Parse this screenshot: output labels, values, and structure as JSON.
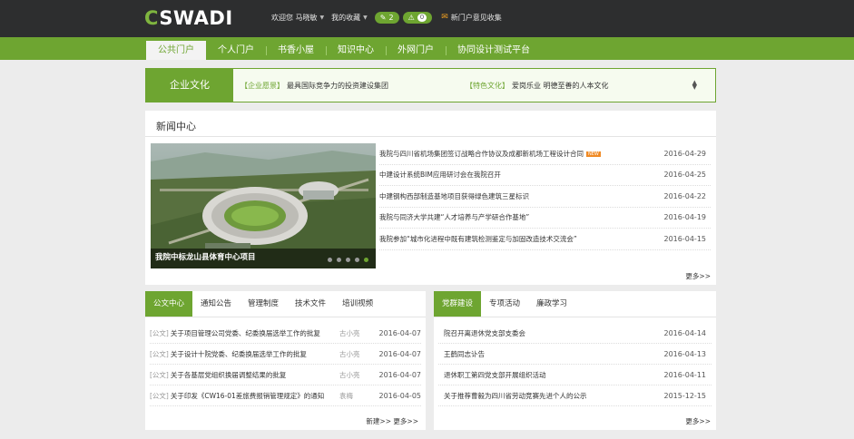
{
  "header": {
    "logo_c": "C",
    "logo_rest": "SWADI",
    "welcome": "欢迎您 马晓敏",
    "favorites": "我的收藏",
    "edit_count": "2",
    "warning_count": "0",
    "feedback": "新门户意见收集"
  },
  "nav": {
    "tabs": [
      "公共门户",
      "个人门户",
      "书香小屋",
      "知识中心",
      "外网门户",
      "协同设计测试平台"
    ]
  },
  "culture": {
    "heading": "企业文化",
    "vision_tag": "【企业愿景】",
    "vision_text": "最具国际竞争力的投资建设集团",
    "feature_tag": "【特色文化】",
    "feature_text": "爱岗乐业 明德至善的人本文化"
  },
  "news": {
    "title": "新闻中心",
    "photo_caption": "我院中标龙山县体育中心项目",
    "more": "更多>>",
    "items": [
      {
        "title": "我院与四川省机场集团签订战略合作协议及成都新机场工程设计合同",
        "badge": "NEW",
        "date": "2016-04-29"
      },
      {
        "title": "中建设计系统BIM应用研讨会在我院召开",
        "date": "2016-04-25"
      },
      {
        "title": "中建钢构西部制造基地项目获得绿色建筑三星标识",
        "date": "2016-04-22"
      },
      {
        "title": "我院与同济大学共建“人才培养与产学研合作基地”",
        "date": "2016-04-19"
      },
      {
        "title": "我院参加“城市化进程中既有建筑检测鉴定与加固改造技术交流会”",
        "date": "2016-04-15"
      }
    ]
  },
  "docs": {
    "tabs": [
      "公文中心",
      "通知公告",
      "管理制度",
      "技术文件",
      "培训视频"
    ],
    "new_link": "新建>>",
    "more": "更多>>",
    "items": [
      {
        "prefix": "[公文]",
        "title": "关于项目管理公司党委、纪委换届选举工作的批复",
        "author": "古小亮",
        "date": "2016-04-07"
      },
      {
        "prefix": "[公文]",
        "title": "关于设计十院党委、纪委换届选举工作的批复",
        "author": "古小亮",
        "date": "2016-04-07"
      },
      {
        "prefix": "[公文]",
        "title": "关于各基层党组织换届调整结果的批复",
        "author": "古小亮",
        "date": "2016-04-07"
      },
      {
        "prefix": "[公文]",
        "title": "关于印发《CW16-01差旅费报销管理规定》的通知",
        "author": "袁梅",
        "date": "2016-04-05"
      }
    ]
  },
  "party": {
    "tabs": [
      "党群建设",
      "专项活动",
      "廉政学习"
    ],
    "more": "更多>>",
    "items": [
      {
        "title": "院召开离退休党支部支委会",
        "date": "2016-04-14"
      },
      {
        "title": "王鹤同志讣告",
        "date": "2016-04-13"
      },
      {
        "title": "退休职工第四党支部开展组织活动",
        "date": "2016-04-11"
      },
      {
        "title": "关于推荐曹毅为四川省劳动竞赛先进个人的公示",
        "date": "2015-12-15"
      }
    ]
  }
}
